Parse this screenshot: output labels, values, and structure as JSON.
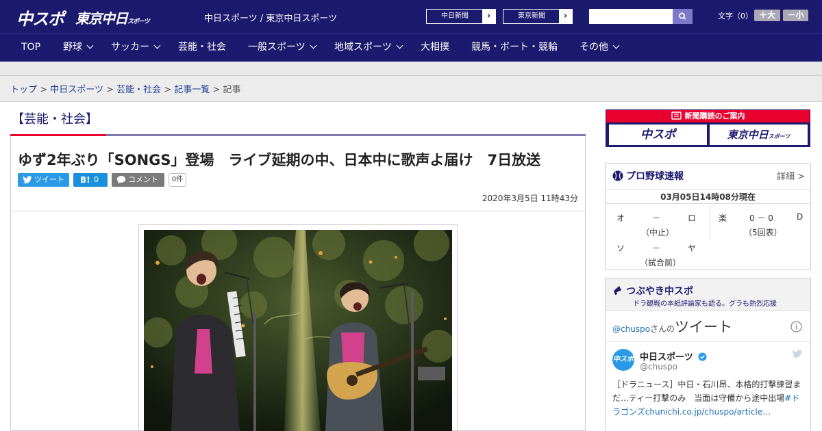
{
  "header": {
    "logo_chuspo": "中スポ",
    "logo_tokyo": "東京中日",
    "logo_tokyo_small": "スポーツ",
    "site_links": "中日スポーツ / 東京中日スポーツ",
    "paper_buttons": [
      "中日新聞",
      "東京新聞"
    ],
    "search": {
      "value": "",
      "placeholder": ""
    },
    "font_size_label": "文字（0）",
    "font_bigger": "＋大",
    "font_smaller": "－小"
  },
  "nav": [
    {
      "label": "TOP",
      "dropdown": false
    },
    {
      "label": "野球",
      "dropdown": true
    },
    {
      "label": "サッカー",
      "dropdown": true
    },
    {
      "label": "芸能・社会",
      "dropdown": false
    },
    {
      "label": "一般スポーツ",
      "dropdown": true
    },
    {
      "label": "地域スポーツ",
      "dropdown": true
    },
    {
      "label": "大相撲",
      "dropdown": false
    },
    {
      "label": "競馬・ボート・競輪",
      "dropdown": false
    },
    {
      "label": "その他",
      "dropdown": true
    }
  ],
  "breadcrumb": {
    "items": [
      "トップ",
      "中日スポーツ",
      "芸能・社会",
      "記事一覧"
    ],
    "current": "記事",
    "separator": ">"
  },
  "article": {
    "category": "【芸能・社会】",
    "title": "ゆず2年ぶり「SONGS」登場　ライブ延期の中、日本中に歌声よ届け　7日放送",
    "tweet_label": "ツイート",
    "hatena_label": "B!",
    "hatena_count": "0",
    "comment_label": "コメント",
    "comment_count": "0件",
    "date": "2020年3月5日 11時43分"
  },
  "sidebar": {
    "promo": {
      "title": "新聞購読のご案内",
      "logos": [
        "中スポ",
        "東京中日"
      ],
      "logo_small": "スポーツ"
    },
    "baseball": {
      "title": "プロ野球速報",
      "detail": "詳細 >",
      "timestamp": "03月05日14時08分現在",
      "games": [
        {
          "home": "オ",
          "score": "－",
          "away": "ロ",
          "status": "（中止）"
        },
        {
          "home": "楽",
          "score": "0 － 0",
          "away": "D",
          "status": "（5回表）"
        },
        {
          "home": "ソ",
          "score": "－",
          "away": "ヤ",
          "status": "（試合前）"
        }
      ]
    },
    "tsubuyaki": {
      "title": "つぶやき中スポ",
      "subtitle": "ドラ観戦の本紙評論家も語る。グラも熱烈応援",
      "tweets_of": "@chuspo",
      "tweets_of_suffix": "さんの",
      "tweets_word": "ツイート",
      "account_name": "中日スポーツ",
      "account_handle": "@chuspo",
      "tweet_text": "［ドラニュース］中日・石川昂、本格的打撃練習まだ…ティー打撃のみ　当面は守備から途中出場",
      "tweet_hashtag": "#ドラゴンズ",
      "tweet_link": "chunichi.co.jp/chuspo/article…"
    }
  },
  "colors": {
    "header_bg": "#1c1a6e",
    "accent_red": "#e8002e",
    "twitter_blue": "#2b9ae6",
    "link_blue": "#1c3f94"
  }
}
